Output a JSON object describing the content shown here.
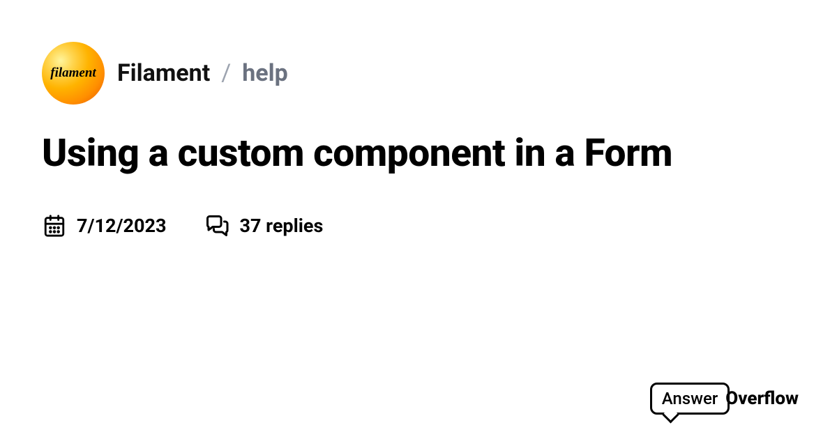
{
  "header": {
    "avatar_label": "filament",
    "community": "Filament",
    "separator": "/",
    "channel": "help"
  },
  "post": {
    "title": "Using a custom component in a Form"
  },
  "meta": {
    "date": "7/12/2023",
    "replies_count": "37 replies"
  },
  "brand": {
    "part1": "Answer",
    "part2": "Overflow"
  }
}
